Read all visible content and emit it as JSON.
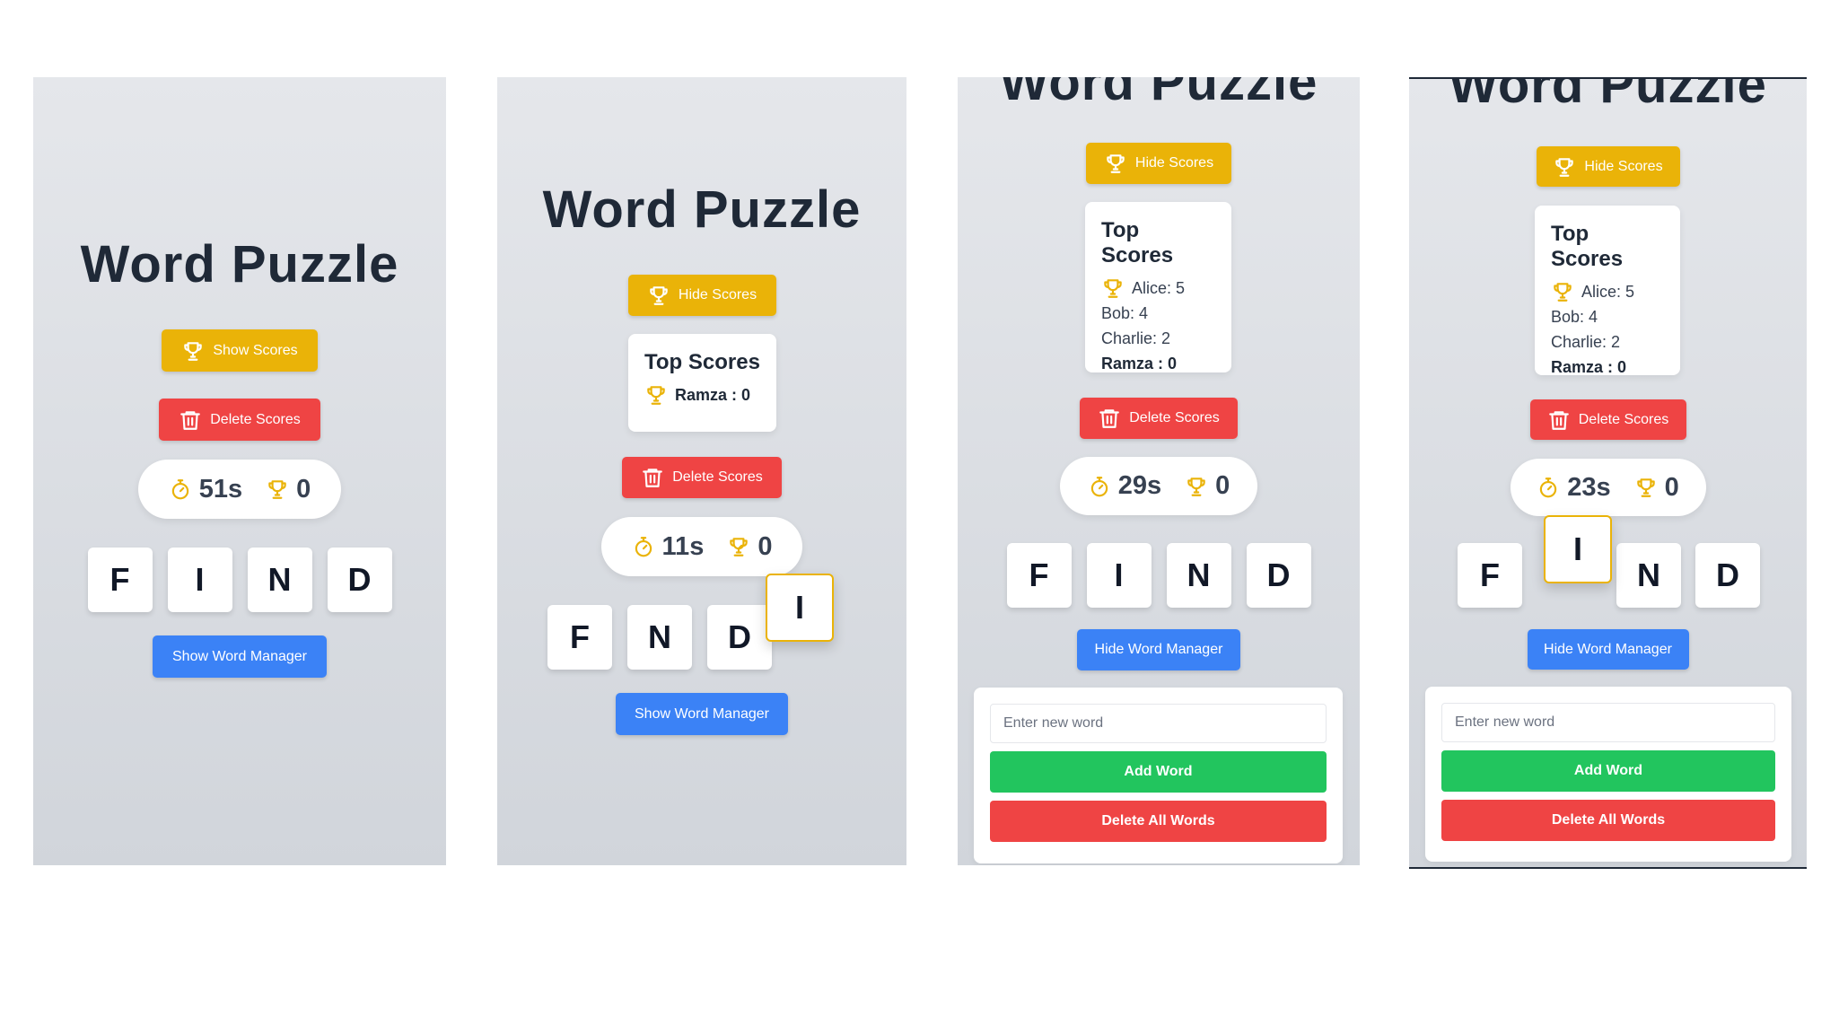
{
  "app_title": "Word Puzzle",
  "colors": {
    "yellow": "#eab308",
    "red": "#ef4444",
    "blue": "#3b82f6",
    "green": "#22c55e",
    "background": "#e5e7eb"
  },
  "icons": [
    "trophy-icon",
    "trash-icon",
    "stopwatch-icon"
  ],
  "screens": [
    {
      "scores_button": "Show Scores",
      "delete_scores_button": "Delete Scores",
      "timer": "51s",
      "score": "0",
      "tiles": [
        "F",
        "I",
        "N",
        "D"
      ],
      "word_manager_button": "Show Word Manager"
    },
    {
      "scores_button": "Hide Scores",
      "scores_title": "Top Scores",
      "scores": [
        "Ramza : 0"
      ],
      "delete_scores_button": "Delete Scores",
      "timer": "11s",
      "score": "0",
      "tiles": [
        "F",
        "N",
        "D"
      ],
      "dragged_tile": "I",
      "word_manager_button": "Show Word Manager"
    },
    {
      "scores_button": "Hide Scores",
      "scores_title": "Top Scores",
      "scores": [
        "Alice: 5",
        "Bob: 4",
        "Charlie: 2",
        "Ramza : 0"
      ],
      "delete_scores_button": "Delete Scores",
      "timer": "29s",
      "score": "0",
      "tiles": [
        "F",
        "I",
        "N",
        "D"
      ],
      "word_manager_button": "Hide Word Manager",
      "word_input_placeholder": "Enter new word",
      "add_word_button": "Add Word",
      "delete_all_words_button": "Delete All Words"
    },
    {
      "scores_button": "Hide Scores",
      "scores_title": "Top Scores",
      "scores": [
        "Alice: 5",
        "Bob: 4",
        "Charlie: 2",
        "Ramza : 0"
      ],
      "delete_scores_button": "Delete Scores",
      "timer": "23s",
      "score": "0",
      "tiles": [
        "F",
        "N",
        "D"
      ],
      "dragged_tile": "I",
      "word_manager_button": "Hide Word Manager",
      "word_input_placeholder": "Enter new word",
      "add_word_button": "Add Word",
      "delete_all_words_button": "Delete All Words"
    }
  ]
}
